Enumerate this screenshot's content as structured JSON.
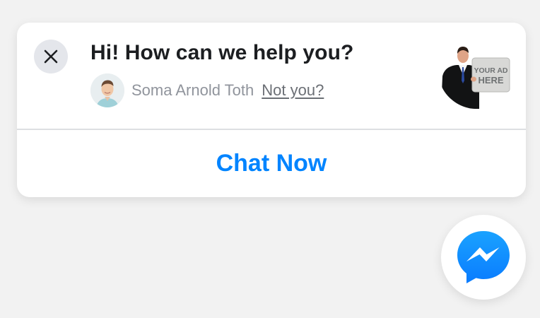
{
  "popup": {
    "title": "Hi! How can we help you?",
    "user_name": "Soma Arnold Toth",
    "not_you_label": "Not you?",
    "ad_text_line1": "YOUR AD",
    "ad_text_line2": "HERE",
    "chat_button_label": "Chat Now",
    "close_icon": "close-icon",
    "avatar_icon": "user-avatar"
  },
  "fab": {
    "icon": "messenger-icon"
  },
  "colors": {
    "accent": "#0084ff",
    "title": "#1c1e21",
    "muted": "#90949c",
    "background": "#f2f2f2"
  }
}
